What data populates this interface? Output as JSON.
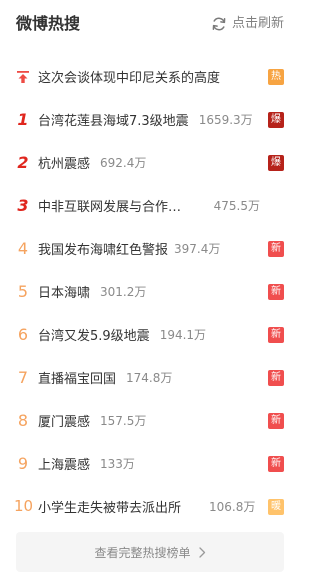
{
  "header": {
    "title": "微博热搜",
    "refresh_label": "点击刷新",
    "refresh_icon": "refresh-icon"
  },
  "colors": {
    "rank_top": "#e0261e",
    "rank_other": "#f5a35f",
    "badge_hot": "#f7a442",
    "badge_boom": "#b6221a",
    "badge_new": "#f04e4e",
    "badge_warm": "#ffc36b",
    "pin": "#ee4b44"
  },
  "items": [
    {
      "rank": "",
      "pinned": true,
      "topic": "这次会谈体现中印尼关系的高度",
      "count": "",
      "badge": "热",
      "badge_type": "hot"
    },
    {
      "rank": "1",
      "topic": "台湾花莲县海域7.3级地震",
      "count": "1659.3万",
      "badge": "爆",
      "badge_type": "boom"
    },
    {
      "rank": "2",
      "topic": "杭州震感",
      "count": "692.4万",
      "badge": "爆",
      "badge_type": "boom"
    },
    {
      "rank": "3",
      "topic": "中非互联网发展与合作论坛",
      "count": "475.5万",
      "badge": "",
      "badge_type": ""
    },
    {
      "rank": "4",
      "topic": "我国发布海啸红色警报",
      "count": "397.4万",
      "badge": "新",
      "badge_type": "new"
    },
    {
      "rank": "5",
      "topic": "日本海啸",
      "count": "301.2万",
      "badge": "新",
      "badge_type": "new"
    },
    {
      "rank": "6",
      "topic": "台湾又发5.9级地震",
      "count": "194.1万",
      "badge": "新",
      "badge_type": "new"
    },
    {
      "rank": "7",
      "topic": "直播福宝回国",
      "count": "174.8万",
      "badge": "新",
      "badge_type": "new"
    },
    {
      "rank": "8",
      "topic": "厦门震感",
      "count": "157.5万",
      "badge": "新",
      "badge_type": "new"
    },
    {
      "rank": "9",
      "topic": "上海震感",
      "count": "133万",
      "badge": "新",
      "badge_type": "new"
    },
    {
      "rank": "10",
      "topic": "小学生走失被带去派出所",
      "count": "106.8万",
      "badge": "暖",
      "badge_type": "warm"
    }
  ],
  "footer": {
    "more_label": "查看完整热搜榜单",
    "chevron_icon": "chevron-right-icon"
  }
}
